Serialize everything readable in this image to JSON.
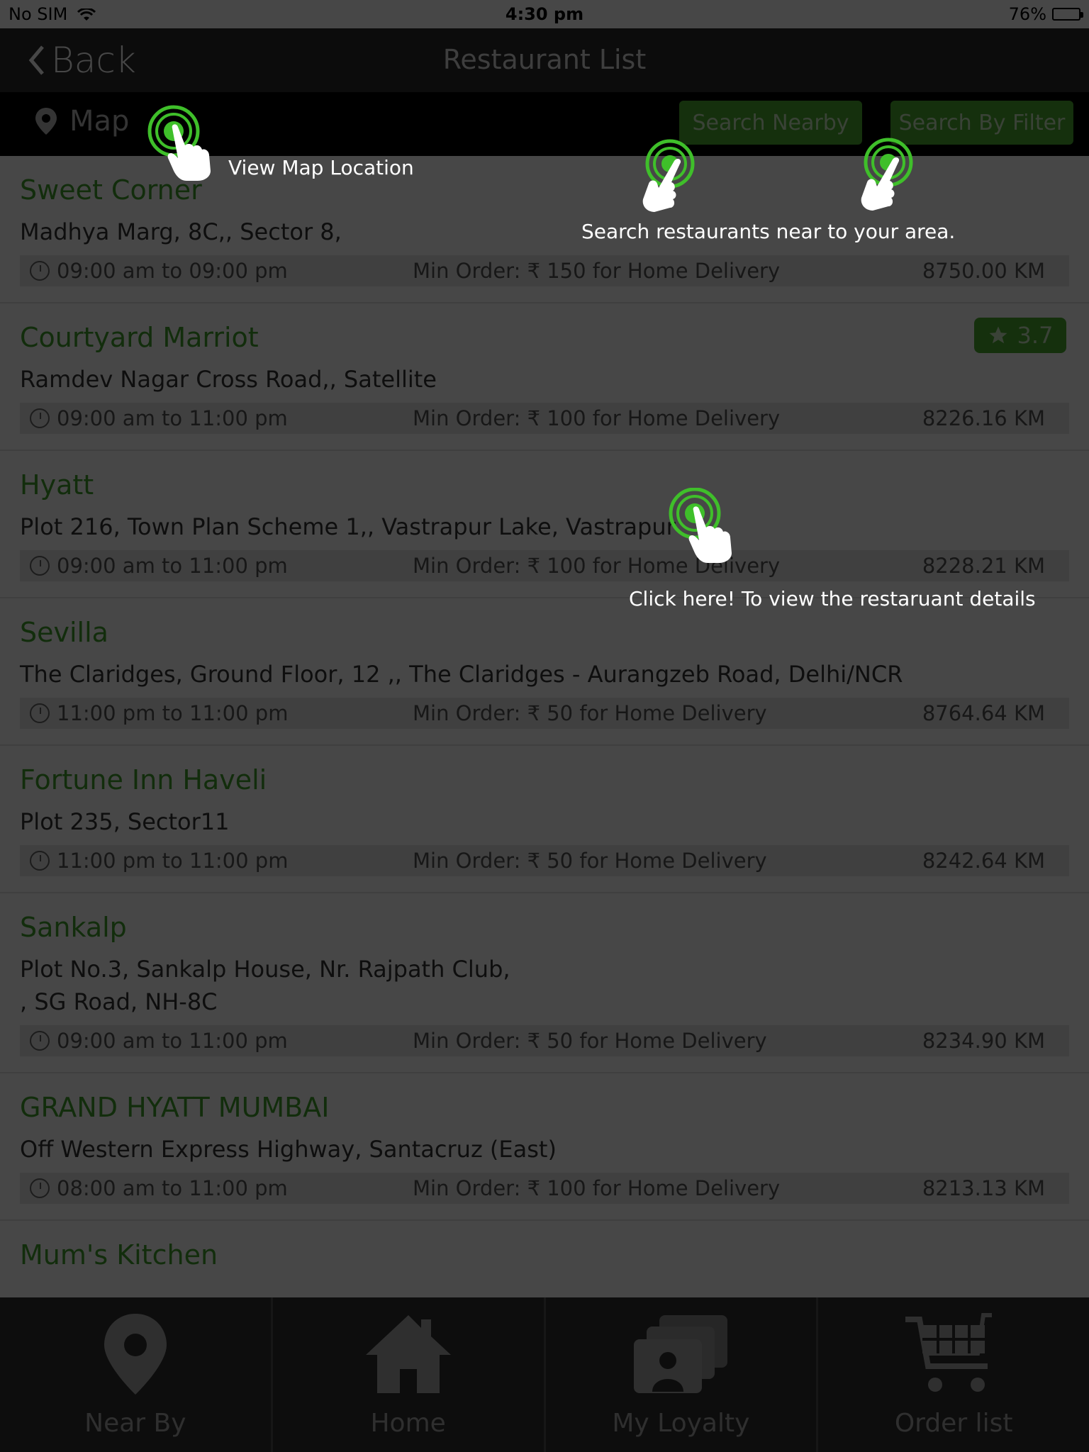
{
  "status": {
    "carrier": "No SIM",
    "time": "4:30 pm",
    "battery": "76%",
    "battery_level": 0.76
  },
  "nav": {
    "back_label": "Back",
    "title": "Restaurant List"
  },
  "toolbar": {
    "map_label": "Map",
    "search_nearby": "Search Nearby",
    "search_filter": "Search By Filter"
  },
  "restaurants": [
    {
      "name": "Sweet Corner",
      "address": "Madhya Marg, 8C,,  Sector 8,",
      "hours": "09:00 am to 09:00 pm",
      "min_order": "Min Order: ₹ 150 for Home Delivery",
      "distance": "8750.00 KM"
    },
    {
      "name": "Courtyard Marriot",
      "address": "Ramdev Nagar Cross Road,, Satellite",
      "hours": "09:00 am to 11:00 pm",
      "min_order": "Min Order: ₹ 100 for Home Delivery",
      "distance": "8226.16 KM",
      "rating": "3.7"
    },
    {
      "name": "Hyatt",
      "address": "Plot 216, Town Plan Scheme 1,, Vastrapur Lake, Vastrapur",
      "hours": "09:00 am to 11:00 pm",
      "min_order": "Min Order: ₹ 100 for Home Delivery",
      "distance": "8228.21 KM"
    },
    {
      "name": "Sevilla",
      "address": "The Claridges, Ground Floor, 12 ,, The Claridges - Aurangzeb Road, Delhi/NCR",
      "hours": "11:00 pm to 11:00 pm",
      "min_order": "Min Order: ₹ 50 for Home Delivery",
      "distance": "8764.64 KM"
    },
    {
      "name": "Fortune Inn Haveli",
      "address": "Plot 235, Sector11",
      "hours": "11:00 pm to 11:00 pm",
      "min_order": "Min Order: ₹ 50 for Home Delivery",
      "distance": "8242.64 KM"
    },
    {
      "name": "Sankalp",
      "address_line1": "Plot No.3, Sankalp House, Nr. Rajpath Club,",
      "address_line2": ", SG Road, NH-8C",
      "hours": "09:00 am to 11:00 pm",
      "min_order": "Min Order: ₹ 50 for Home Delivery",
      "distance": "8234.90 KM"
    },
    {
      "name": "GRAND HYATT MUMBAI",
      "address": "Off Western Express Highway, Santacruz (East)",
      "hours": "08:00 am to 11:00 pm",
      "min_order": "Min Order: ₹ 100 for Home Delivery",
      "distance": "8213.13 KM"
    },
    {
      "name": "Mum's Kitchen"
    }
  ],
  "tabs": [
    "Near By",
    "Home",
    "My Loyalty",
    "Order list"
  ],
  "hints": {
    "map": "View Map Location",
    "search": "Search restaurants near to your area.",
    "details": "Click here! To view the restaruant details"
  },
  "colors": {
    "accent": "#4cae2f",
    "overlay": "rgba(0,0,0,0.72)"
  }
}
